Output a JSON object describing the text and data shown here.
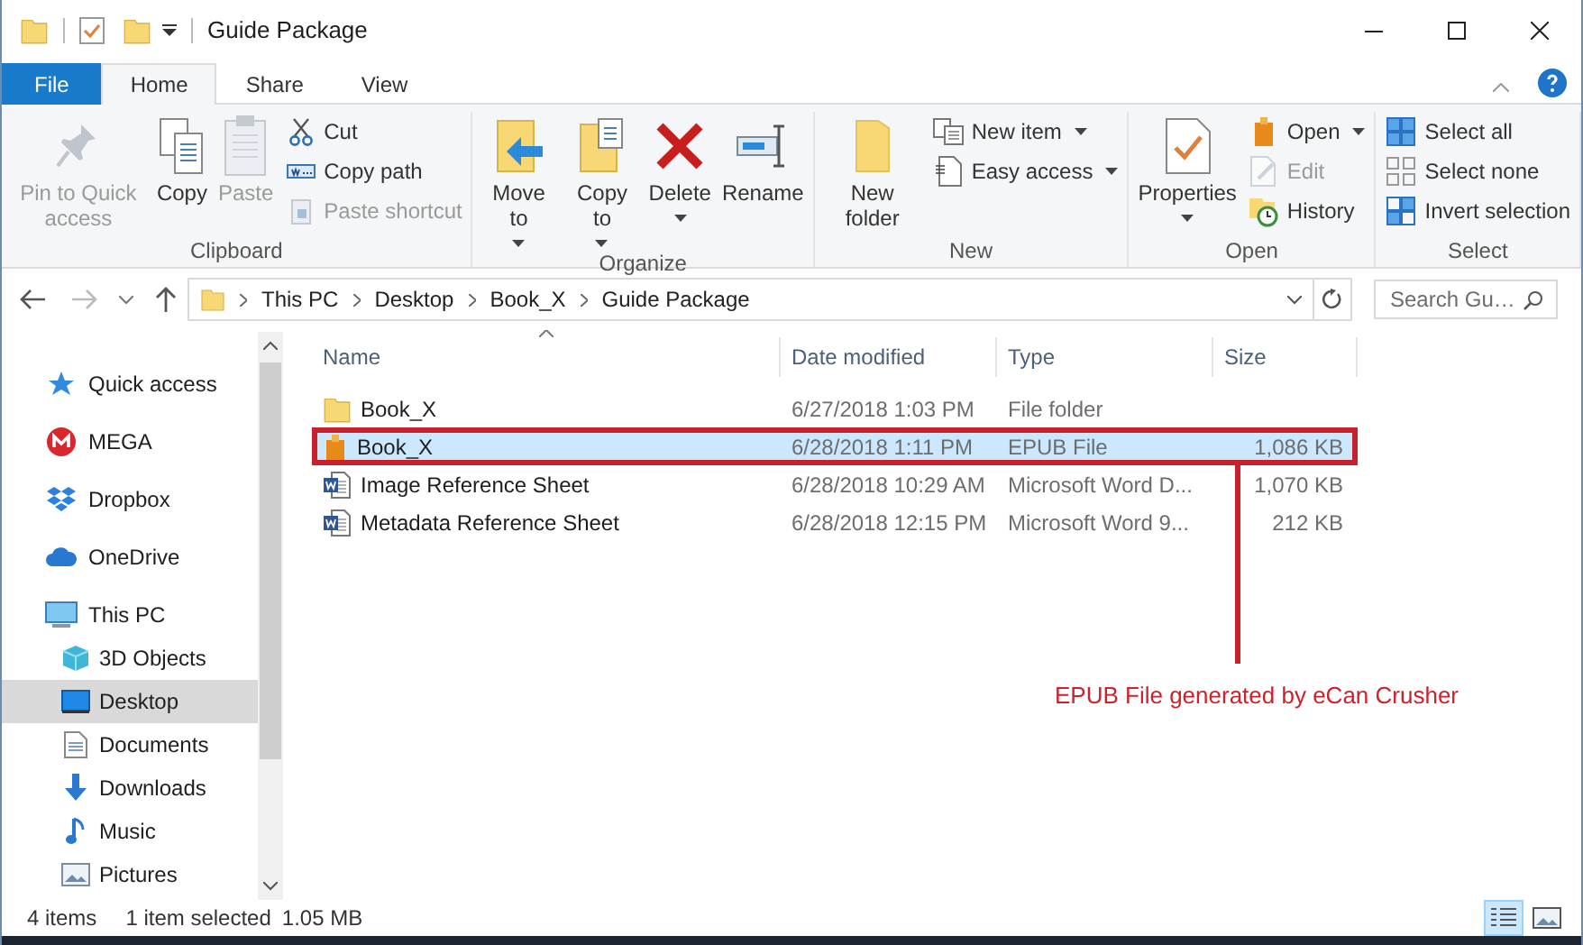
{
  "window": {
    "title": "Guide Package"
  },
  "tabs": [
    {
      "label": "File",
      "kind": "file",
      "selected": false
    },
    {
      "label": "Home",
      "kind": "tab",
      "selected": true
    },
    {
      "label": "Share",
      "kind": "tab",
      "selected": false
    },
    {
      "label": "View",
      "kind": "tab",
      "selected": false
    }
  ],
  "ribbon": {
    "groups": [
      {
        "label": "Clipboard",
        "large": [
          {
            "label": "Pin to Quick access",
            "disabled": true,
            "dropdown": false
          },
          {
            "label": "Copy",
            "disabled": false,
            "dropdown": false
          },
          {
            "label": "Paste",
            "disabled": true,
            "dropdown": false
          }
        ],
        "small": [
          {
            "label": "Cut",
            "disabled": false,
            "dropdown": false
          },
          {
            "label": "Copy path",
            "disabled": false,
            "dropdown": false
          },
          {
            "label": "Paste shortcut",
            "disabled": true,
            "dropdown": false
          }
        ]
      },
      {
        "label": "Organize",
        "large": [
          {
            "label": "Move to",
            "disabled": false,
            "dropdown": true
          },
          {
            "label": "Copy to",
            "disabled": false,
            "dropdown": true
          },
          {
            "label": "Delete",
            "disabled": false,
            "dropdown": true
          },
          {
            "label": "Rename",
            "disabled": false,
            "dropdown": false
          }
        ]
      },
      {
        "label": "New",
        "large": [
          {
            "label": "New folder",
            "disabled": false,
            "dropdown": false
          }
        ],
        "small": [
          {
            "label": "New item",
            "disabled": false,
            "dropdown": true
          },
          {
            "label": "Easy access",
            "disabled": false,
            "dropdown": true
          }
        ]
      },
      {
        "label": "Open",
        "large": [
          {
            "label": "Properties",
            "disabled": false,
            "dropdown": true
          }
        ],
        "small": [
          {
            "label": "Open",
            "disabled": false,
            "dropdown": true
          },
          {
            "label": "Edit",
            "disabled": true,
            "dropdown": false
          },
          {
            "label": "History",
            "disabled": false,
            "dropdown": false
          }
        ]
      },
      {
        "label": "Select",
        "small": [
          {
            "label": "Select all",
            "disabled": false,
            "dropdown": false
          },
          {
            "label": "Select none",
            "disabled": false,
            "dropdown": false
          },
          {
            "label": "Invert selection",
            "disabled": false,
            "dropdown": false
          }
        ]
      }
    ]
  },
  "address": {
    "crumbs": [
      "This PC",
      "Desktop",
      "Book_X",
      "Guide Package"
    ]
  },
  "search": {
    "placeholder": "Search Gu…"
  },
  "nav": {
    "items": [
      {
        "label": "Quick access",
        "selected": false
      },
      {
        "label": "MEGA",
        "selected": false
      },
      {
        "label": "Dropbox",
        "selected": false
      },
      {
        "label": "OneDrive",
        "selected": false
      },
      {
        "label": "This PC",
        "selected": false,
        "children": [
          {
            "label": "3D Objects",
            "selected": false
          },
          {
            "label": "Desktop",
            "selected": true
          },
          {
            "label": "Documents",
            "selected": false
          },
          {
            "label": "Downloads",
            "selected": false
          },
          {
            "label": "Music",
            "selected": false
          },
          {
            "label": "Pictures",
            "selected": false
          }
        ]
      }
    ]
  },
  "table": {
    "columns": [
      "Name",
      "Date modified",
      "Type",
      "Size"
    ],
    "rows": [
      {
        "kind": "folder",
        "name": "Book_X",
        "date": "6/27/2018 1:03 PM",
        "type": "File folder",
        "size": "",
        "selected": false,
        "annotated": false
      },
      {
        "kind": "epub",
        "name": "Book_X",
        "date": "6/28/2018 1:11 PM",
        "type": "EPUB File",
        "size": "1,086 KB",
        "selected": true,
        "annotated": true
      },
      {
        "kind": "word",
        "name": "Image Reference Sheet",
        "date": "6/28/2018 10:29 AM",
        "type": "Microsoft Word D...",
        "size": "1,070 KB",
        "selected": false,
        "annotated": false
      },
      {
        "kind": "word",
        "name": "Metadata Reference Sheet",
        "date": "6/28/2018 12:15 PM",
        "type": "Microsoft Word 9...",
        "size": "212 KB",
        "selected": false,
        "annotated": false
      }
    ]
  },
  "annotation": {
    "text": "EPUB File generated by eCan Crusher"
  },
  "status_bar": {
    "items": "4 items",
    "selection": "1 item selected",
    "size": "1.05 MB"
  },
  "views": [
    {
      "kind": "details",
      "selected": true
    },
    {
      "kind": "large-icons",
      "selected": false
    }
  ]
}
